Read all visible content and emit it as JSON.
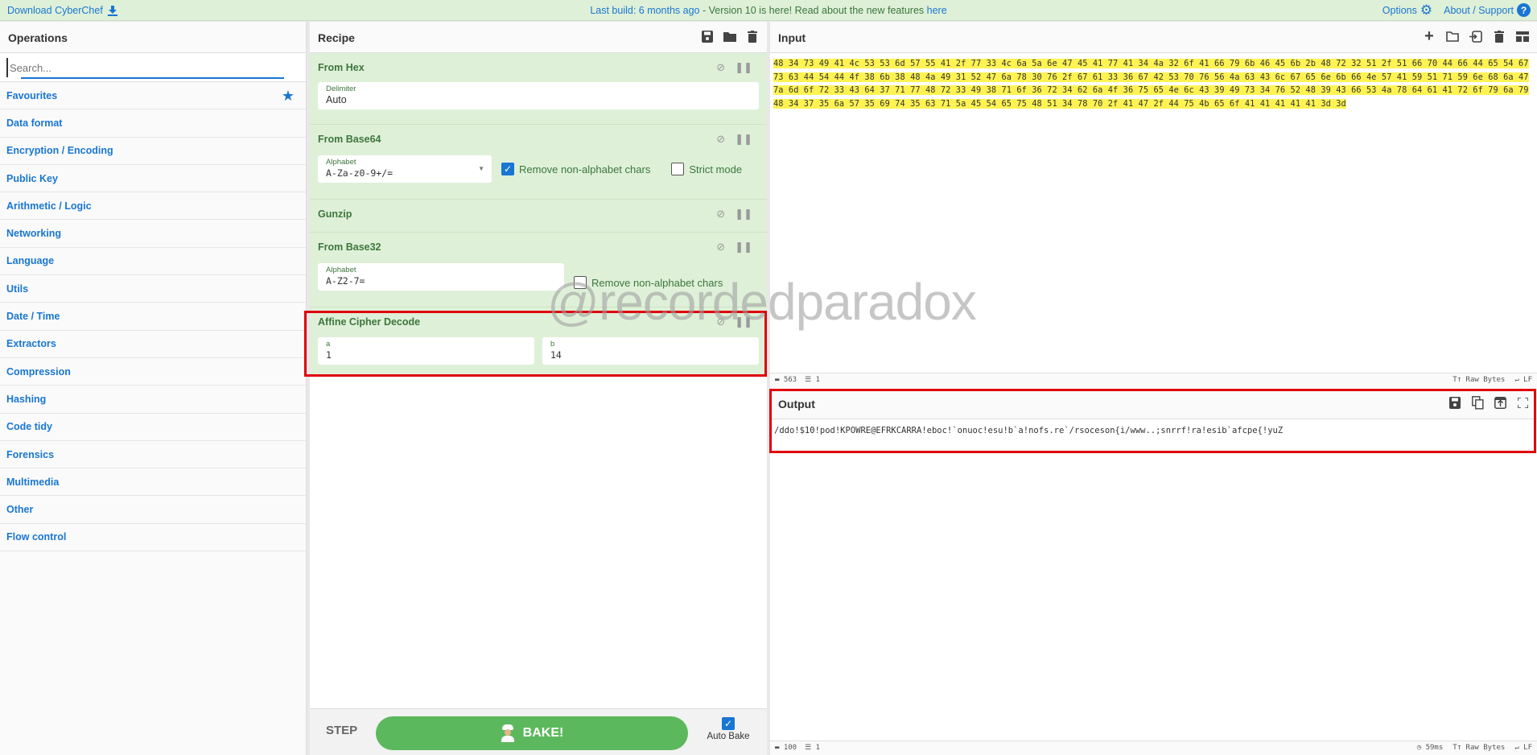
{
  "banner": {
    "download_label": "Download CyberChef",
    "build_text": "Last build: 6 months ago",
    "version_text": " - Version 10 is here! Read about the new features ",
    "here_link": "here",
    "options_label": "Options",
    "about_label": "About / Support",
    "about_icon": "?"
  },
  "operations": {
    "title": "Operations",
    "search_placeholder": "Search...",
    "categories": [
      "Favourites",
      "Data format",
      "Encryption / Encoding",
      "Public Key",
      "Arithmetic / Logic",
      "Networking",
      "Language",
      "Utils",
      "Date / Time",
      "Extractors",
      "Compression",
      "Hashing",
      "Code tidy",
      "Forensics",
      "Multimedia",
      "Other",
      "Flow control"
    ]
  },
  "recipe": {
    "title": "Recipe",
    "ops": {
      "from_hex": {
        "title": "From Hex",
        "delimiter_label": "Delimiter",
        "delimiter_value": "Auto"
      },
      "from_base64": {
        "title": "From Base64",
        "alphabet_label": "Alphabet",
        "alphabet_value": "A-Za-z0-9+/=",
        "remove_label": "Remove non-alphabet chars",
        "remove_checked": true,
        "strict_label": "Strict mode",
        "strict_checked": false
      },
      "gunzip": {
        "title": "Gunzip"
      },
      "from_base32": {
        "title": "From Base32",
        "alphabet_label": "Alphabet",
        "alphabet_value": "A-Z2-7=",
        "remove_label": "Remove non-alphabet chars",
        "remove_checked": false
      },
      "affine": {
        "title": "Affine Cipher Decode",
        "a_label": "a",
        "a_value": "1",
        "b_label": "b",
        "b_value": "14"
      }
    },
    "step_label": "STEP",
    "bake_label": "BAKE!",
    "autobake_label": "Auto Bake",
    "autobake_checked": true
  },
  "input": {
    "title": "Input",
    "text": "48 34 73 49 41 4c 53 53 6d 57 55 41 2f 77 33 4c 6a 5a 6e 47 45 41 77 41 34 4a 32 6f 41 66 79 6b 46 45 6b 2b 48 72 32 51 2f 51 66 70 44 66 44 65 54 67 73 63 44 54 44 4f 38 6b 38 48 4a 49 31 52 47 6a 78 30 76 2f 67 61 33 36 67 42 53 70 76 56 4a 63 43 6c 67 65 6e 6b 66 4e 57 41 59 51 71 59 6e 68 6a 47 7a 6d 6f 72 33 43 64 37 71 77 48 72 33 49 38 71 6f 36 72 34 62 6a 4f 36 75 65 4e 6c 43 39 49 73 34 76 52 48 39 43 66 53 4a 78 64 61 41 72 6f 79 6a 79 48 34 37 35 6a 57 35 69 74 35 63 71 5a 45 54 65 75 48 51 34 78 70 2f 41 47 2f 44 75 4b 65 6f 41 41 41 41 41 3d 3d",
    "status": {
      "length": "563",
      "lines": "1",
      "encoding": "Raw Bytes",
      "eol": "LF"
    }
  },
  "output": {
    "title": "Output",
    "text": "/ddo!$10!pod!KPOWRE@EFRKCARRA!eboc!`onuoc!esu!b`a!nofs.re`/rsoceson{i/www..;snrrf!ra!esib`afcpe{!yuZ",
    "status": {
      "length": "100",
      "lines": "1",
      "time": "59ms",
      "encoding": "Raw Bytes",
      "eol": "LF"
    }
  },
  "watermark": "@recordedparadox",
  "colors": {
    "accent": "#1976d2",
    "op_bg": "#dff0d8",
    "op_text": "#3c763d",
    "bake": "#5cb85c",
    "highlight": "#fff353",
    "annotation_red": "#e0000b"
  }
}
